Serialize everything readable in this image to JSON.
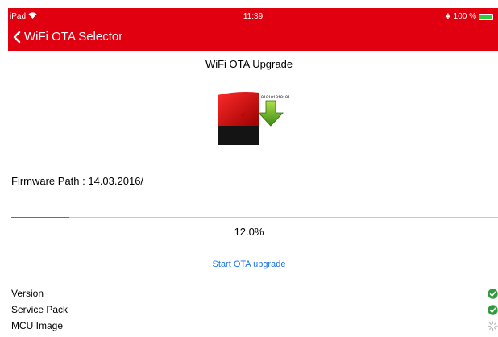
{
  "statusbar": {
    "device": "iPad",
    "time": "11:39",
    "battery": "100 %"
  },
  "navbar": {
    "back_label": "WiFi OTA Selector"
  },
  "page": {
    "title": "WiFi OTA Upgrade",
    "binary_text": "010101010101",
    "firmware_path": "Firmware Path : 14.03.2016/",
    "progress_fraction": 0.12,
    "progress_label": "12.0%",
    "start_button": "Start OTA upgrade"
  },
  "items": [
    {
      "label": "Version",
      "status": "done",
      "icon": "check-circle-icon"
    },
    {
      "label": "Service Pack",
      "status": "done",
      "icon": "check-circle-icon"
    },
    {
      "label": "MCU Image",
      "status": "in-progress",
      "icon": "spinner-icon"
    }
  ],
  "colors": {
    "accent": "#e0000f",
    "link": "#1a73e8",
    "check": "#2e9d3a",
    "progress": "#1e7ef5"
  }
}
